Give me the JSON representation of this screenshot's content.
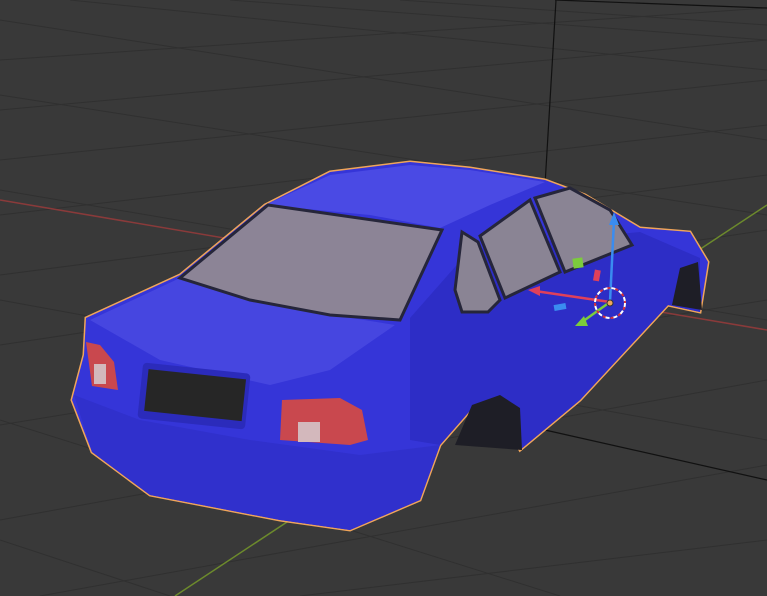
{
  "viewport": {
    "background": "#393939",
    "grid_color": "#2f2f2f",
    "axis_x_color": "#8a3a3a",
    "axis_y_color": "#6c8a2c",
    "selection_outline_color": "#f0a55a"
  },
  "object": {
    "name_icon": "car-body-mesh",
    "body_color": "#3434d6",
    "body_shadow_color": "#2424b0",
    "glass_color": "#8c8496",
    "plate_color": "#2a2a2a",
    "taillight_color": "#c8484a"
  },
  "gizmo": {
    "x_axis_color": "#e0405a",
    "y_axis_color": "#7ccc3c",
    "z_axis_color": "#3a8cf0",
    "cursor_icon": "3d-cursor-icon"
  }
}
